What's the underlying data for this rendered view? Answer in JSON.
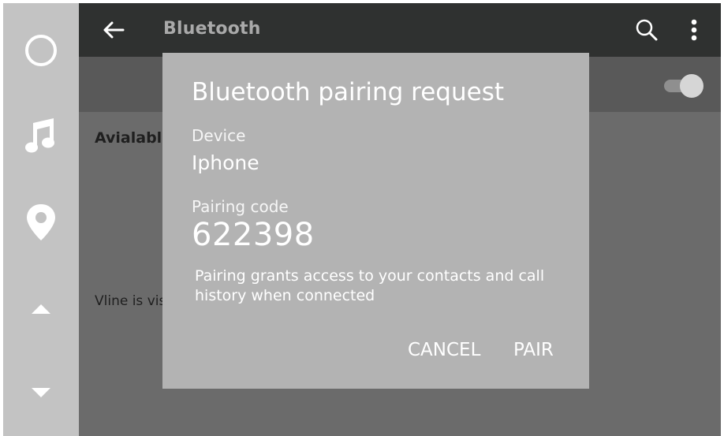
{
  "header": {
    "title": "Bluetooth"
  },
  "icons": {
    "home": "circle-icon",
    "music": "music-note-icon",
    "location": "map-pin-icon",
    "scroll_up": "triangle-up-icon",
    "scroll_down": "triangle-down-icon",
    "back": "arrow-left-icon",
    "search": "search-icon",
    "more": "more-vertical-icon"
  },
  "colors": {
    "rail": "#c3c3c3",
    "topbar": "#2f3130",
    "content": "#6b6b6b",
    "dialog": "#b3b3b3"
  },
  "toggle": {
    "on": true
  },
  "main": {
    "section_label": "Avialable",
    "visibility_note": "Vline is vis"
  },
  "dialog": {
    "title": "Bluetooth pairing request",
    "device_label": "Device",
    "device_value": "Iphone",
    "code_label": "Pairing code",
    "code_value": "622398",
    "note": "Pairing grants access to your contacts and call history when connected",
    "cancel_label": "CANCEL",
    "pair_label": "PAIR"
  }
}
